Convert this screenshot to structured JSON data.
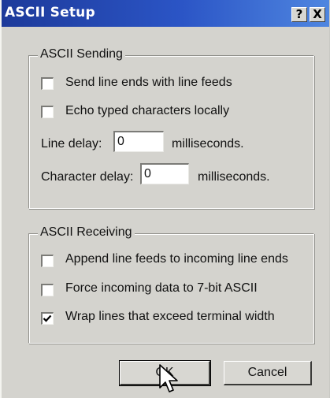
{
  "window": {
    "title": "ASCII Setup",
    "help_glyph": "?",
    "close_glyph": "X"
  },
  "sending": {
    "group_label": "ASCII Sending",
    "send_line_ends": {
      "label": "Send line ends with line feeds",
      "checked": false
    },
    "echo_typed": {
      "label": "Echo typed characters locally",
      "checked": false
    },
    "line_delay": {
      "label": "Line delay:",
      "value": "0",
      "unit": "milliseconds."
    },
    "character_delay": {
      "label": "Character delay:",
      "value": "0",
      "unit": "milliseconds."
    }
  },
  "receiving": {
    "group_label": "ASCII Receiving",
    "append_line_feeds": {
      "label": "Append line feeds to incoming line ends",
      "checked": false
    },
    "force_7bit": {
      "label": "Force incoming data to 7-bit ASCII",
      "checked": false
    },
    "wrap_lines": {
      "label": "Wrap lines that exceed terminal width",
      "checked": true
    }
  },
  "buttons": {
    "ok": "OK",
    "cancel": "Cancel"
  },
  "icons": {
    "checkmark": "checkmark-icon",
    "cursor": "mouse-pointer-icon"
  },
  "colors": {
    "titlebar_start": "#1d3a9a",
    "titlebar_end": "#4f86e0",
    "face": "#d4d3ce"
  }
}
